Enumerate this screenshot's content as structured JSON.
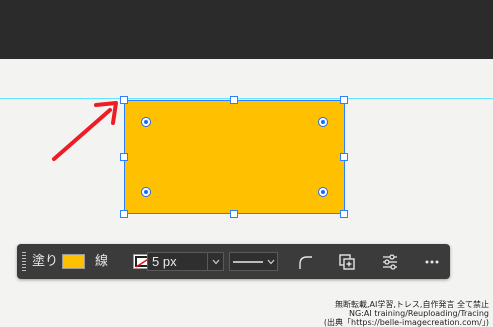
{
  "colors": {
    "shape_fill": "#ffc000",
    "selection": "#2f80ff",
    "guide": "#66e6ff",
    "arrow": "#ee1c24",
    "toolbar_bg": "#3b3b3b"
  },
  "toolbar": {
    "fill_label": "塗り",
    "stroke_label": "線",
    "stroke_width_value": "5 px",
    "icons": [
      "corner-radius-icon",
      "add-to-library-icon",
      "more-settings-icon",
      "more-options-icon"
    ]
  },
  "watermark": {
    "line1": "無断転載,AI学習,トレス,自作発言 全て禁止",
    "line2": "NG:AI training/Reuploading/Tracing",
    "line3": "(出典「https://belle-imagecreation.com/」)"
  }
}
